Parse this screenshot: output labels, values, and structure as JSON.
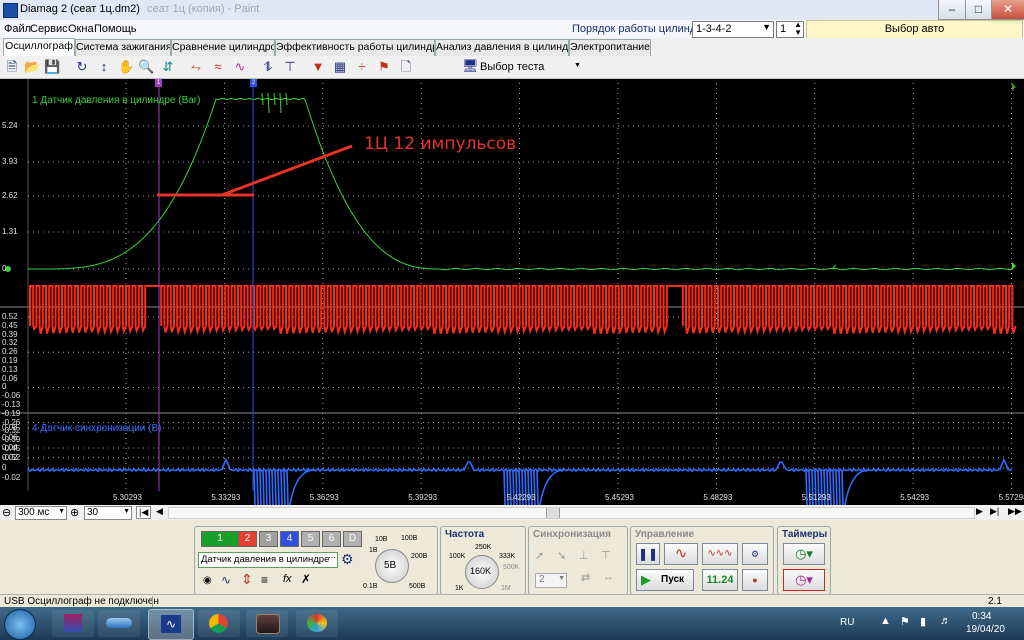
{
  "window": {
    "title": "Diamag 2 (сеат 1ц.dm2)",
    "title_faded": "сеат 1ц (копия) - Paint"
  },
  "menu": [
    "Файл",
    "Сервис",
    "Окна",
    "Помощь"
  ],
  "header": {
    "firing_order_label": "Порядок работы цилиндров",
    "firing_order_value": "1-3-4-2",
    "cylinder_value": "1",
    "auto_select_label": "Выбор авто"
  },
  "tabs": [
    "Осциллограф",
    "Система зажигания",
    "Сравнение цилиндров",
    "Эффективность работы цилиндров",
    "Анализ давления в цилиндре",
    "Электропитание"
  ],
  "toolbar": {
    "test_select_label": "Выбор теста"
  },
  "scope": {
    "channel1": {
      "title": "1 Датчик давления в цилиндре (Bar)",
      "ticks": [
        "5.24",
        "3.93",
        "2.62",
        "1.31",
        "0"
      ],
      "color": "#39d239"
    },
    "channel2": {
      "ticks": [
        "0.52",
        "0.45",
        "0.39",
        "0.32",
        "0.26",
        "0.19",
        "0.13",
        "0.06",
        "0",
        "-0.06",
        "-0.13",
        "-0.19",
        "-0.26",
        "-0.32",
        "-0.39",
        "-0.45",
        "-0.52"
      ],
      "color": "#ff2a1a"
    },
    "channel4": {
      "title": "4 Датчик синхронизации (В)",
      "ticks": [
        "0.08",
        "0.06",
        "0.04",
        "0.02",
        "0",
        "-0.02"
      ],
      "color": "#2f6cff"
    },
    "x_ticks": [
      "5.30293",
      "5.33293",
      "5.36293",
      "5.39293",
      "5.42293",
      "5.45293",
      "5.48293",
      "5.51293",
      "5.54293",
      "5.57293"
    ],
    "annotation": "1Ц 12 импульсов",
    "markers": [
      "1",
      "2"
    ]
  },
  "scrollrow": {
    "time_value": "300 мс",
    "count_value": "30"
  },
  "controls": {
    "channel_buttons": [
      "1",
      "2",
      "3",
      "4",
      "5",
      "6",
      "D"
    ],
    "sensor_select": "Датчик давления в цилиндре",
    "voltage": {
      "center": "5В",
      "labels": [
        "1В",
        "10В",
        "200В",
        "500В",
        "0.1В",
        "100В"
      ]
    },
    "frequency": {
      "title": "Частота",
      "center": "160K",
      "labels": [
        "100K",
        "250K",
        "333K",
        "500K",
        "1K",
        "1M"
      ]
    },
    "sync": {
      "title": "Синхронизация",
      "value": "2"
    },
    "control": {
      "title": "Управление",
      "start_label": "Пуск",
      "voltage_readout": "11.24"
    },
    "timers": {
      "title": "Таймеры"
    }
  },
  "status": {
    "left": "USB Осциллограф не подключен",
    "right": "2.1"
  },
  "taskbar": {
    "lang": "RU",
    "time": "0:34",
    "date": "19/04/20"
  }
}
